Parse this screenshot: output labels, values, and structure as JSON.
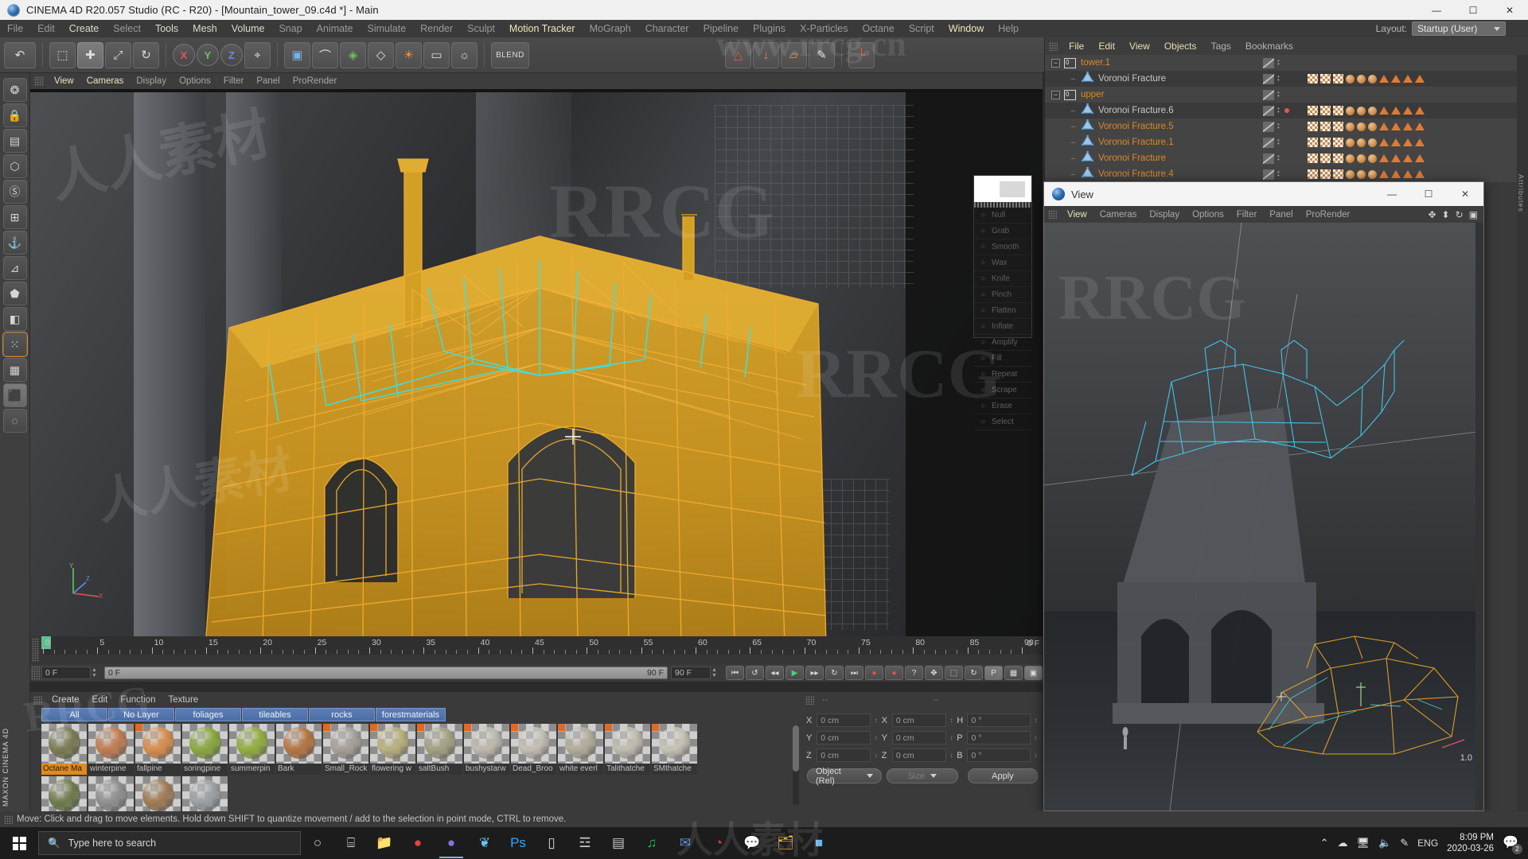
{
  "titlebar": {
    "title": "CINEMA 4D R20.057 Studio (RC - R20) - [Mountain_tower_09.c4d *] - Main",
    "minimize": "—",
    "maximize": "☐",
    "close": "✕",
    "app_icon": "c4d-logo-icon"
  },
  "menubar": {
    "items": [
      {
        "label": "File",
        "state": "dim"
      },
      {
        "label": "Edit",
        "state": "dim"
      },
      {
        "label": "Create",
        "state": "lit"
      },
      {
        "label": "Select",
        "state": "dim"
      },
      {
        "label": "Tools",
        "state": "lit"
      },
      {
        "label": "Mesh",
        "state": "lit"
      },
      {
        "label": "Volume",
        "state": "lit"
      },
      {
        "label": "Snap",
        "state": "dim"
      },
      {
        "label": "Animate",
        "state": "dim"
      },
      {
        "label": "Simulate",
        "state": "dim"
      },
      {
        "label": "Render",
        "state": "dim"
      },
      {
        "label": "Sculpt",
        "state": "dim"
      },
      {
        "label": "Motion Tracker",
        "state": "hi"
      },
      {
        "label": "MoGraph",
        "state": "dim"
      },
      {
        "label": "Character",
        "state": "dim"
      },
      {
        "label": "Pipeline",
        "state": "dim"
      },
      {
        "label": "Plugins",
        "state": "dim"
      },
      {
        "label": "X-Particles",
        "state": "dim"
      },
      {
        "label": "Octane",
        "state": "dim"
      },
      {
        "label": "Script",
        "state": "dim"
      },
      {
        "label": "Window",
        "state": "hi"
      },
      {
        "label": "Help",
        "state": "dim"
      }
    ],
    "layout_label": "Layout:",
    "layout_value": "Startup (User)"
  },
  "toolbar": {
    "undo": "↶",
    "redo": "↷",
    "buttons": [
      {
        "name": "live-selection",
        "glyph": "⬚"
      },
      {
        "name": "move-tool",
        "glyph": "✚"
      },
      {
        "name": "scale-tool",
        "glyph": "⤢"
      },
      {
        "name": "rotate-tool",
        "glyph": "↻"
      },
      {
        "name": "axis-x",
        "glyph": "X"
      },
      {
        "name": "axis-y",
        "glyph": "Y"
      },
      {
        "name": "axis-z",
        "glyph": "Z"
      },
      {
        "name": "world-coordinates",
        "glyph": "⌖"
      },
      {
        "name": "cube-primitive",
        "glyph": "▣"
      },
      {
        "name": "spline-pen",
        "glyph": "⌒"
      },
      {
        "name": "generator",
        "glyph": "◈"
      },
      {
        "name": "deformer",
        "glyph": "◇"
      },
      {
        "name": "environment",
        "glyph": "☀"
      },
      {
        "name": "camera",
        "glyph": "▭"
      },
      {
        "name": "light",
        "glyph": "☀"
      },
      {
        "name": "blend-mode",
        "glyph": "BLEND"
      },
      {
        "name": "render-view",
        "glyph": "▶"
      },
      {
        "name": "render-region",
        "glyph": "▷"
      },
      {
        "name": "render-settings",
        "glyph": "⚙"
      },
      {
        "name": "voronoi-fracture",
        "glyph": "△"
      },
      {
        "name": "drop-to-floor",
        "glyph": "↓"
      },
      {
        "name": "connect-object",
        "glyph": "▱"
      },
      {
        "name": "paint-tool",
        "glyph": "✎"
      },
      {
        "name": "axis-gizmo",
        "glyph": "┗"
      }
    ]
  },
  "left_tools": {
    "brand": "MAXON CINEMA 4D",
    "items": [
      {
        "name": "live-selection-icon",
        "glyph": "◌"
      },
      {
        "name": "model-mode-icon",
        "glyph": "⬛"
      },
      {
        "name": "texture-mode-icon",
        "glyph": "▦"
      },
      {
        "name": "points-mode-icon",
        "glyph": "⁙"
      },
      {
        "name": "edges-mode-icon",
        "glyph": "◧"
      },
      {
        "name": "polygons-mode-icon",
        "glyph": "⬟"
      },
      {
        "name": "axis-mode-icon",
        "glyph": "⊿"
      },
      {
        "name": "lock-axis-icon",
        "glyph": "⚓"
      },
      {
        "name": "uv-mode-icon",
        "glyph": "⊞"
      },
      {
        "name": "snap-icon",
        "glyph": "Ⓢ"
      },
      {
        "name": "workplane-icon",
        "glyph": "⬡"
      },
      {
        "name": "quantize-icon",
        "glyph": "▤"
      },
      {
        "name": "lock-icon",
        "glyph": "🔒"
      },
      {
        "name": "enable-axis-icon",
        "glyph": "❂"
      }
    ]
  },
  "viewport": {
    "menu": [
      {
        "label": "View",
        "state": "lit"
      },
      {
        "label": "Cameras",
        "state": "lit"
      },
      {
        "label": "Display",
        "state": "dim"
      },
      {
        "label": "Options",
        "state": "dim"
      },
      {
        "label": "Filter",
        "state": "dim"
      },
      {
        "label": "Panel",
        "state": "dim"
      },
      {
        "label": "ProRender",
        "state": "dim"
      }
    ],
    "axis_labels": {
      "x": "X",
      "y": "Y",
      "z": "Z"
    },
    "popup_tools": [
      {
        "label": "Null",
        "icon": "null-icon"
      },
      {
        "label": "Grab",
        "icon": "grab-icon"
      },
      {
        "label": "Smooth",
        "icon": "smooth-icon"
      },
      {
        "label": "Wax",
        "icon": "wax-icon"
      },
      {
        "label": "Knife",
        "icon": "knife-icon"
      },
      {
        "label": "Pinch",
        "icon": "pinch-icon"
      },
      {
        "label": "Flatten",
        "icon": "flatten-icon"
      },
      {
        "label": "Inflate",
        "icon": "inflate-icon"
      },
      {
        "label": "Amplify",
        "icon": "amplify-icon"
      },
      {
        "label": "Fill",
        "icon": "fill-icon"
      },
      {
        "label": "Repeat",
        "icon": "repeat-icon"
      },
      {
        "label": "Scrape",
        "icon": "scrape-icon"
      },
      {
        "label": "Erase",
        "icon": "erase-icon"
      },
      {
        "label": "Select",
        "icon": "select-icon"
      }
    ]
  },
  "timeline": {
    "ticks": [
      "0",
      "5",
      "10",
      "15",
      "20",
      "25",
      "30",
      "35",
      "40",
      "45",
      "50",
      "55",
      "60",
      "65",
      "70",
      "75",
      "80",
      "85",
      "90"
    ],
    "end_marker": "0 F",
    "current_frame": "0 F",
    "range_start": "0 F",
    "range_end": "90 F",
    "preview_end": "90 F",
    "transport": [
      {
        "name": "goto-start",
        "glyph": "⏮"
      },
      {
        "name": "loop",
        "glyph": "↺"
      },
      {
        "name": "step-back",
        "glyph": "◂◂"
      },
      {
        "name": "play",
        "glyph": "▶"
      },
      {
        "name": "step-forward",
        "glyph": "▸▸"
      },
      {
        "name": "play-reverse",
        "glyph": "↻"
      },
      {
        "name": "goto-end",
        "glyph": "⏭"
      },
      {
        "name": "record",
        "glyph": "●"
      },
      {
        "name": "autokey",
        "glyph": "●"
      },
      {
        "name": "keyframe-help",
        "glyph": "?"
      },
      {
        "name": "key-position",
        "glyph": "✥"
      },
      {
        "name": "key-scale",
        "glyph": "⬚"
      },
      {
        "name": "key-rotation",
        "glyph": "↻"
      },
      {
        "name": "key-param",
        "glyph": "P"
      },
      {
        "name": "key-pla",
        "glyph": "▦"
      },
      {
        "name": "layout-toggle",
        "glyph": "▣"
      }
    ]
  },
  "material_manager": {
    "menu": [
      "Create",
      "Edit",
      "Function",
      "Texture"
    ],
    "tabs": [
      {
        "label": "All"
      },
      {
        "label": "No Layer"
      },
      {
        "label": "foliages"
      },
      {
        "label": "tileables"
      },
      {
        "label": "rocks"
      },
      {
        "label": "forestmaterials"
      }
    ],
    "materials": [
      {
        "name": "Octane Ma",
        "color": "#7a7a52",
        "selected": true,
        "corner": false
      },
      {
        "name": "winterpine",
        "color": "#c27a4e",
        "selected": false,
        "corner": false
      },
      {
        "name": "fallpine",
        "color": "#d98c4a",
        "selected": false,
        "corner": true
      },
      {
        "name": "soringpine",
        "color": "#8aa83a",
        "selected": false,
        "corner": false
      },
      {
        "name": "summerpin",
        "color": "#93ad3c",
        "selected": false,
        "corner": false
      },
      {
        "name": "Bark",
        "color": "#b57440",
        "selected": false,
        "corner": false
      },
      {
        "name": "Small_Rock",
        "color": "#a5a098",
        "selected": false,
        "corner": true
      },
      {
        "name": "flowering w",
        "color": "#b8b07e",
        "selected": false,
        "corner": true
      },
      {
        "name": "saltBush",
        "color": "#a3a181",
        "selected": false,
        "corner": true
      },
      {
        "name": "bushystarw",
        "color": "#bdb9ad",
        "selected": false,
        "corner": true
      },
      {
        "name": "Dead_Broo",
        "color": "#c3bfb4",
        "selected": false,
        "corner": true
      },
      {
        "name": "white everl",
        "color": "#b2ac9c",
        "selected": false,
        "corner": true
      },
      {
        "name": "Talithatche",
        "color": "#c0bcb0",
        "selected": false,
        "corner": true
      },
      {
        "name": "SMthatche",
        "color": "#c6c2b6",
        "selected": false,
        "corner": true
      }
    ],
    "materials_row2": [
      {
        "name": "",
        "color": "#6d7a4a",
        "selected": false,
        "corner": false
      },
      {
        "name": "",
        "color": "#8f8f8f",
        "selected": false,
        "corner": false
      },
      {
        "name": "",
        "color": "#a07a52",
        "selected": false,
        "corner": false
      },
      {
        "name": "",
        "color": "#9aa0a4",
        "selected": false,
        "corner": false
      }
    ]
  },
  "coordinates": {
    "rows": [
      {
        "pos_label": "X",
        "pos_value": "0 cm",
        "size_label": "X",
        "size_value": "0 cm",
        "rot_label": "H",
        "rot_value": "0 °"
      },
      {
        "pos_label": "Y",
        "pos_value": "0 cm",
        "size_label": "Y",
        "size_value": "0 cm",
        "rot_label": "P",
        "rot_value": "0 °"
      },
      {
        "pos_label": "Z",
        "pos_value": "0 cm",
        "size_label": "Z",
        "size_value": "0 cm",
        "rot_label": "B",
        "rot_value": "0 °"
      }
    ],
    "mode": "Object (Rel)",
    "size_mode": "Size",
    "apply": "Apply"
  },
  "object_manager": {
    "menu": [
      "File",
      "Edit",
      "View",
      "Objects",
      "Tags",
      "Bookmarks"
    ],
    "tree": [
      {
        "label": "tower.1",
        "type": "null",
        "depth": 0,
        "color": "orange",
        "expanded": true,
        "selected": true,
        "reddot": false
      },
      {
        "label": "Voronoi Fracture",
        "type": "voronoi",
        "depth": 1,
        "color": "grey",
        "expanded": false,
        "selected": false,
        "reddot": false
      },
      {
        "label": "upper",
        "type": "null",
        "depth": 0,
        "color": "orange",
        "expanded": true,
        "selected": true,
        "reddot": false
      },
      {
        "label": "Voronoi Fracture.6",
        "type": "voronoi",
        "depth": 1,
        "color": "grey",
        "expanded": false,
        "selected": false,
        "reddot": true
      },
      {
        "label": "Voronoi Fracture.5",
        "type": "voronoi",
        "depth": 1,
        "color": "orange",
        "expanded": false,
        "selected": true,
        "reddot": false
      },
      {
        "label": "Voronoi Fracture.1",
        "type": "voronoi",
        "depth": 1,
        "color": "orange",
        "expanded": false,
        "selected": true,
        "reddot": false
      },
      {
        "label": "Voronoi Fracture",
        "type": "voronoi",
        "depth": 1,
        "color": "orange",
        "expanded": false,
        "selected": true,
        "reddot": false
      },
      {
        "label": "Voronoi Fracture.4",
        "type": "voronoi",
        "depth": 1,
        "color": "orange",
        "expanded": false,
        "selected": true,
        "reddot": false
      }
    ],
    "side_label": "Attributes"
  },
  "float_window": {
    "title": "View",
    "minimize": "—",
    "maximize": "☐",
    "close": "✕",
    "menu": [
      {
        "label": "View",
        "state": "lit"
      },
      {
        "label": "Cameras",
        "state": "dim"
      },
      {
        "label": "Display",
        "state": "dim"
      },
      {
        "label": "Options",
        "state": "dim"
      },
      {
        "label": "Filter",
        "state": "dim"
      },
      {
        "label": "Panel",
        "state": "dim"
      },
      {
        "label": "ProRender",
        "state": "dim"
      }
    ],
    "icons": [
      "move-view-icon",
      "scale-view-icon",
      "rotate-view-icon",
      "panel-layout-icon"
    ],
    "zoom_value": "1.0"
  },
  "statusbar": {
    "text": "Move: Click and drag to move elements. Hold down SHIFT to quantize movement / add to the selection in point mode, CTRL to remove."
  },
  "taskbar": {
    "search_placeholder": "Type here to search",
    "items": [
      {
        "name": "cortana-icon",
        "glyph": "○"
      },
      {
        "name": "task-view-icon",
        "glyph": "⌸"
      },
      {
        "name": "file-explorer-icon",
        "glyph": "📁"
      },
      {
        "name": "chrome-icon",
        "glyph": "●"
      },
      {
        "name": "cinema4d-icon",
        "glyph": "●"
      },
      {
        "name": "steam-icon",
        "glyph": "❦"
      },
      {
        "name": "photoshop-icon",
        "glyph": "Ps"
      },
      {
        "name": "notepad-icon",
        "glyph": "▯"
      },
      {
        "name": "substance-icon",
        "glyph": "☲"
      },
      {
        "name": "file2-icon",
        "glyph": "▤"
      },
      {
        "name": "spotify-icon",
        "glyph": "♫"
      },
      {
        "name": "mail-icon",
        "glyph": "✉"
      },
      {
        "name": "opera-icon",
        "glyph": "◔"
      },
      {
        "name": "wechat-icon",
        "glyph": "💬"
      },
      {
        "name": "folder2-icon",
        "glyph": "🗂"
      },
      {
        "name": "app-icon",
        "glyph": "■"
      }
    ],
    "tray": [
      {
        "name": "show-hidden-icons",
        "glyph": "ⱏ"
      },
      {
        "name": "onedrive-icon",
        "glyph": "☁"
      },
      {
        "name": "network-icon",
        "glyph": "❖"
      },
      {
        "name": "volume-icon",
        "glyph": "🔊"
      },
      {
        "name": "pen-icon",
        "glyph": "✎"
      }
    ],
    "language": "ENG",
    "time": "8:09 PM",
    "date": "2020-03-26",
    "notification_count": "2"
  },
  "watermarks": [
    "RRCG",
    "人人素材",
    "www.rrcg.cn"
  ],
  "colors": {
    "accent_orange": "#d98a2b",
    "selection_orange": "#e08a1e",
    "wire_orange": "#e8a32a",
    "wire_cyan": "#3fd8d8",
    "wire_blue": "#4ec8f0",
    "tab_blue": "#4a6ea6",
    "play_green": "#4fd07a",
    "record_red": "#e05050"
  }
}
